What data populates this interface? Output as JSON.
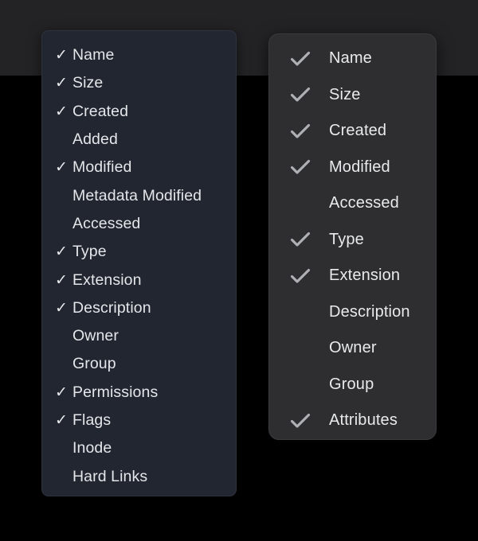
{
  "window": {
    "backdrop_color": "#000000",
    "top_band_color": "#232325"
  },
  "menus": [
    {
      "name": "column-menu-left",
      "background_color": "#222630",
      "text_color": "#e4e6ea",
      "check_glyph": "✓",
      "items": [
        {
          "label": "Name",
          "checked": true
        },
        {
          "label": "Size",
          "checked": true
        },
        {
          "label": "Created",
          "checked": true
        },
        {
          "label": "Added",
          "checked": false
        },
        {
          "label": "Modified",
          "checked": true
        },
        {
          "label": "Metadata Modified",
          "checked": false
        },
        {
          "label": "Accessed",
          "checked": false
        },
        {
          "label": "Type",
          "checked": true
        },
        {
          "label": "Extension",
          "checked": true
        },
        {
          "label": "Description",
          "checked": true
        },
        {
          "label": "Owner",
          "checked": false
        },
        {
          "label": "Group",
          "checked": false
        },
        {
          "label": "Permissions",
          "checked": true
        },
        {
          "label": "Flags",
          "checked": true
        },
        {
          "label": "Inode",
          "checked": false
        },
        {
          "label": "Hard Links",
          "checked": false
        }
      ]
    },
    {
      "name": "column-menu-right",
      "background_color": "#2e2e30",
      "text_color": "#e9eaec",
      "check_glyph": "✓",
      "items": [
        {
          "label": "Name",
          "checked": true
        },
        {
          "label": "Size",
          "checked": true
        },
        {
          "label": "Created",
          "checked": true
        },
        {
          "label": "Modified",
          "checked": true
        },
        {
          "label": "Accessed",
          "checked": false
        },
        {
          "label": "Type",
          "checked": true
        },
        {
          "label": "Extension",
          "checked": true
        },
        {
          "label": "Description",
          "checked": false
        },
        {
          "label": "Owner",
          "checked": false
        },
        {
          "label": "Group",
          "checked": false
        },
        {
          "label": "Attributes",
          "checked": true
        }
      ]
    }
  ]
}
